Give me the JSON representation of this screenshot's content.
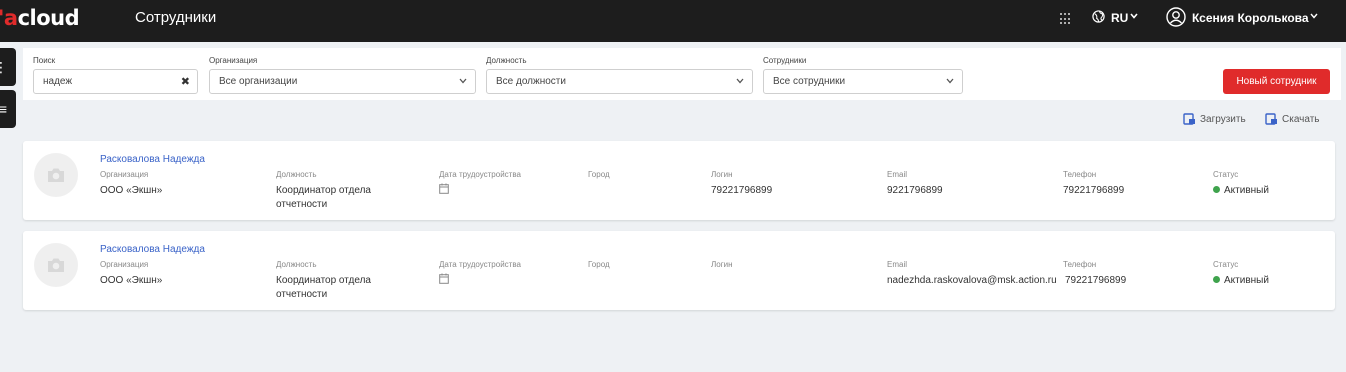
{
  "header": {
    "logo_accent": "'a",
    "logo_rest": "cloud",
    "page_title": "Сотрудники",
    "language": "RU",
    "user_name": "Ксения Королькова"
  },
  "side_tabs": [
    "⋮",
    "≡"
  ],
  "filters": {
    "search": {
      "label": "Поиск",
      "value": "надеж",
      "clear": "✖"
    },
    "organization": {
      "label": "Организация",
      "value": "Все организации"
    },
    "position": {
      "label": "Должность",
      "value": "Все должности"
    },
    "employees": {
      "label": "Сотрудники",
      "value": "Все сотрудники"
    },
    "new_button": "Новый сотрудник"
  },
  "actions": {
    "upload": "Загрузить",
    "download": "Скачать"
  },
  "labels": {
    "organization": "Организация",
    "position": "Должность",
    "hire_date": "Дата трудоустройства",
    "city": "Город",
    "login": "Логин",
    "email": "Email",
    "phone": "Телефон",
    "status": "Статус"
  },
  "employees": [
    {
      "name": "Расковалова Надежда",
      "organization": "ООО «Экшн»",
      "position_line1": "Координатор отдела",
      "position_line2": "отчетности",
      "city": "",
      "login": "79221796899",
      "email": "9221796899",
      "phone": "79221796899",
      "status": "Активный"
    },
    {
      "name": "Расковалова Надежда",
      "organization": "ООО «Экшн»",
      "position_line1": "Координатор отдела",
      "position_line2": "отчетности",
      "city": "",
      "login": "",
      "email": "nadezhda.raskovalova@msk.action.ru",
      "phone": "79221796899",
      "status": "Активный"
    }
  ],
  "colors": {
    "topbar": "#1d1d1d",
    "accent_red": "#e02b2b",
    "link_blue": "#3a63c8",
    "status_green": "#3fa34d"
  }
}
